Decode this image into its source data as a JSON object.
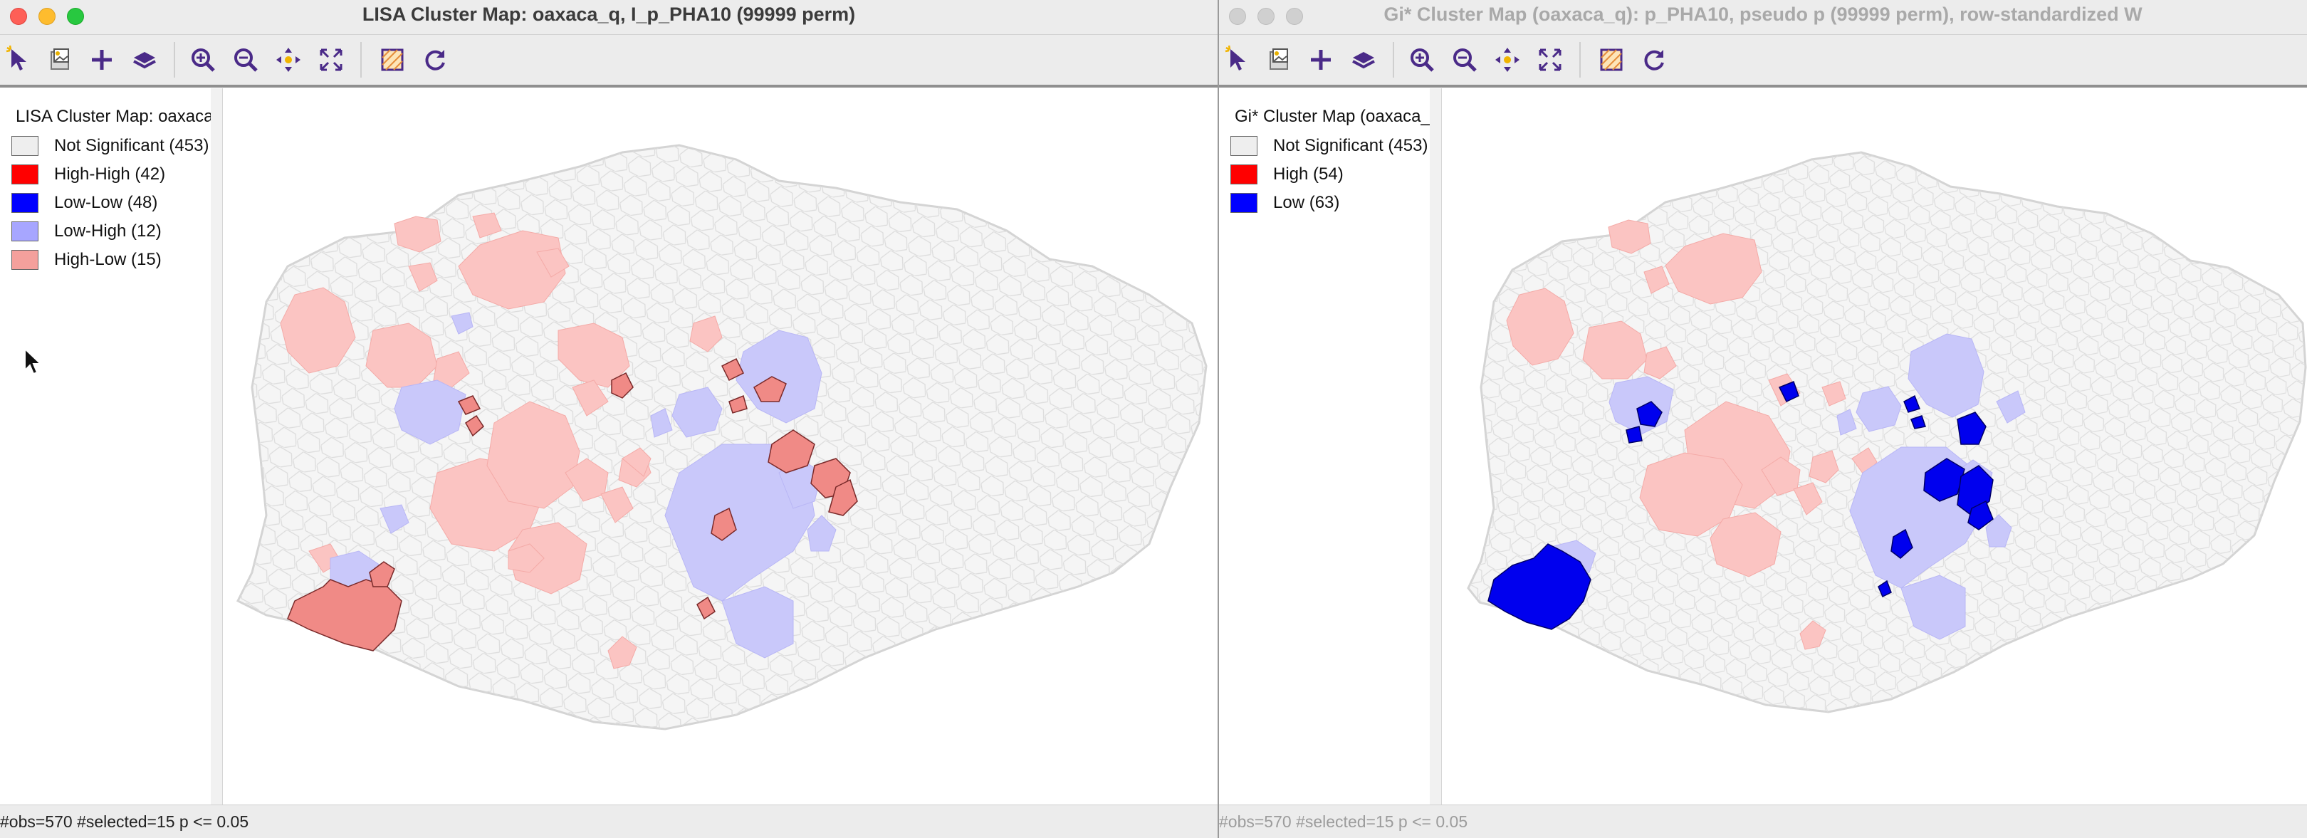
{
  "left_window": {
    "title": "LISA Cluster Map: oaxaca_q, I_p_PHA10 (99999 perm)",
    "legend_title": "LISA Cluster Map: oaxaca_q",
    "legend_items": [
      {
        "label": "Not Significant (453)",
        "color": "#eeeeee"
      },
      {
        "label": "High-High (42)",
        "color": "#ff0000"
      },
      {
        "label": "Low-Low (48)",
        "color": "#0000ff"
      },
      {
        "label": "Low-High (12)",
        "color": "#a7a6ff"
      },
      {
        "label": "High-Low (15)",
        "color": "#f4a09c"
      }
    ],
    "status": "#obs=570 #selected=15   p <= 0.05"
  },
  "right_window": {
    "title": "Gi* Cluster Map (oaxaca_q): p_PHA10, pseudo p (99999 perm), row-standardized W",
    "legend_title": "Gi* Cluster Map (oaxaca_q",
    "legend_items": [
      {
        "label": "Not Significant (453)",
        "color": "#eeeeee"
      },
      {
        "label": "High (54)",
        "color": "#ff0000"
      },
      {
        "label": "Low (63)",
        "color": "#0000ff"
      }
    ],
    "status": "#obs=570 #selected=15   p <= 0.05"
  },
  "toolbar": {
    "tools": [
      "select-tool",
      "copy-image-tool",
      "add-shape-tool",
      "layers-tool",
      "zoom-in-tool",
      "zoom-out-tool",
      "pan-tool",
      "fit-extent-tool",
      "basemap-tool",
      "refresh-tool"
    ]
  },
  "colors": {
    "not_significant": "#f5f5f5",
    "outline": "#d9d9d9",
    "high_faded": "#fbc4c2",
    "high_high_selected": "#f08a86",
    "low_faded": "#c9c8fa",
    "low_strong": "#0000ee"
  }
}
